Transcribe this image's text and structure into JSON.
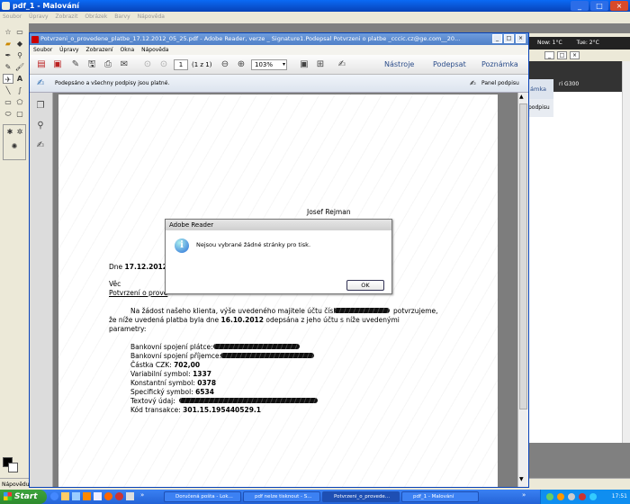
{
  "paint": {
    "title": "pdf_1 - Malování",
    "menu": [
      "Soubor",
      "Úpravy",
      "Zobrazit",
      "Obrázek",
      "Barvy",
      "Nápověda"
    ],
    "status": "Nápovědu zí"
  },
  "adobe": {
    "title": "Potvrzeni_o_provedene_platbe_17.12.2012_05_25.pdf - Adobe Reader, verze _ Signature1.Podepsal Potvrzeni o platbe _cccic.cz@ge.com__20...",
    "menu": [
      "Soubor",
      "Úpravy",
      "Zobrazení",
      "Okna",
      "Nápověda"
    ],
    "page_current": "1",
    "page_total": "(1 z 1)",
    "zoom": "103%",
    "tools_label": "Nástroje",
    "sign_label": "Podepsat",
    "comment_label": "Poznámka",
    "sig_message": "Podepsáno a všechny podpisy jsou platné.",
    "sig_panel": "Panel podpisu"
  },
  "document": {
    "name": "Josef Rejman",
    "date_label": "Dne",
    "date_value": "17.12.2012",
    "subject_label": "Věc",
    "subject_text": "Potvrzení o prove",
    "para1_a": "Na žádost našeho klienta, výše uvedeného majitele účtu čísla",
    "para1_b": "potvrzujeme,",
    "para2_a": "že níže uvedená platba byla dne",
    "para2_date": "16.10.2012",
    "para2_b": "odepsána z jeho účtu s níže uvedenými",
    "para3": "parametry:",
    "fields": [
      {
        "label": "Bankovní spojení plátce:",
        "value": ""
      },
      {
        "label": "Bankovní spojení příjemce:",
        "value": ""
      },
      {
        "label": "Částka CZK:",
        "value": "702,00"
      },
      {
        "label": "Variabilní symbol:",
        "value": "1337"
      },
      {
        "label": "Konstantní symbol:",
        "value": "0378"
      },
      {
        "label": "Specifický symbol:",
        "value": "6534"
      },
      {
        "label": "Textový údaj:",
        "value": ""
      },
      {
        "label": "Kód transakce:",
        "value": "301.15.195440529.1"
      }
    ]
  },
  "dialog": {
    "title": "Adobe Reader",
    "message": "Nejsou vybrané žádné stránky pro tisk.",
    "ok": "OK"
  },
  "browser": {
    "weather1": "Now: 1°C",
    "weather2": "Tue: 2°C",
    "tab_label": "ámka",
    "panel_label": "podpisu",
    "ad_text": "ri G300"
  },
  "taskbar": {
    "start": "Start",
    "tasks": [
      "Doručená pošta - Lok...",
      "pdf nelze tisknout - S...",
      "Potvrzeni_o_provede...",
      "pdf_1 - Malování"
    ],
    "clock": "17:51"
  },
  "colors": {
    "accent": "#2463d7",
    "page": "#ffffff",
    "doc_bg": "#7d7d7d"
  }
}
